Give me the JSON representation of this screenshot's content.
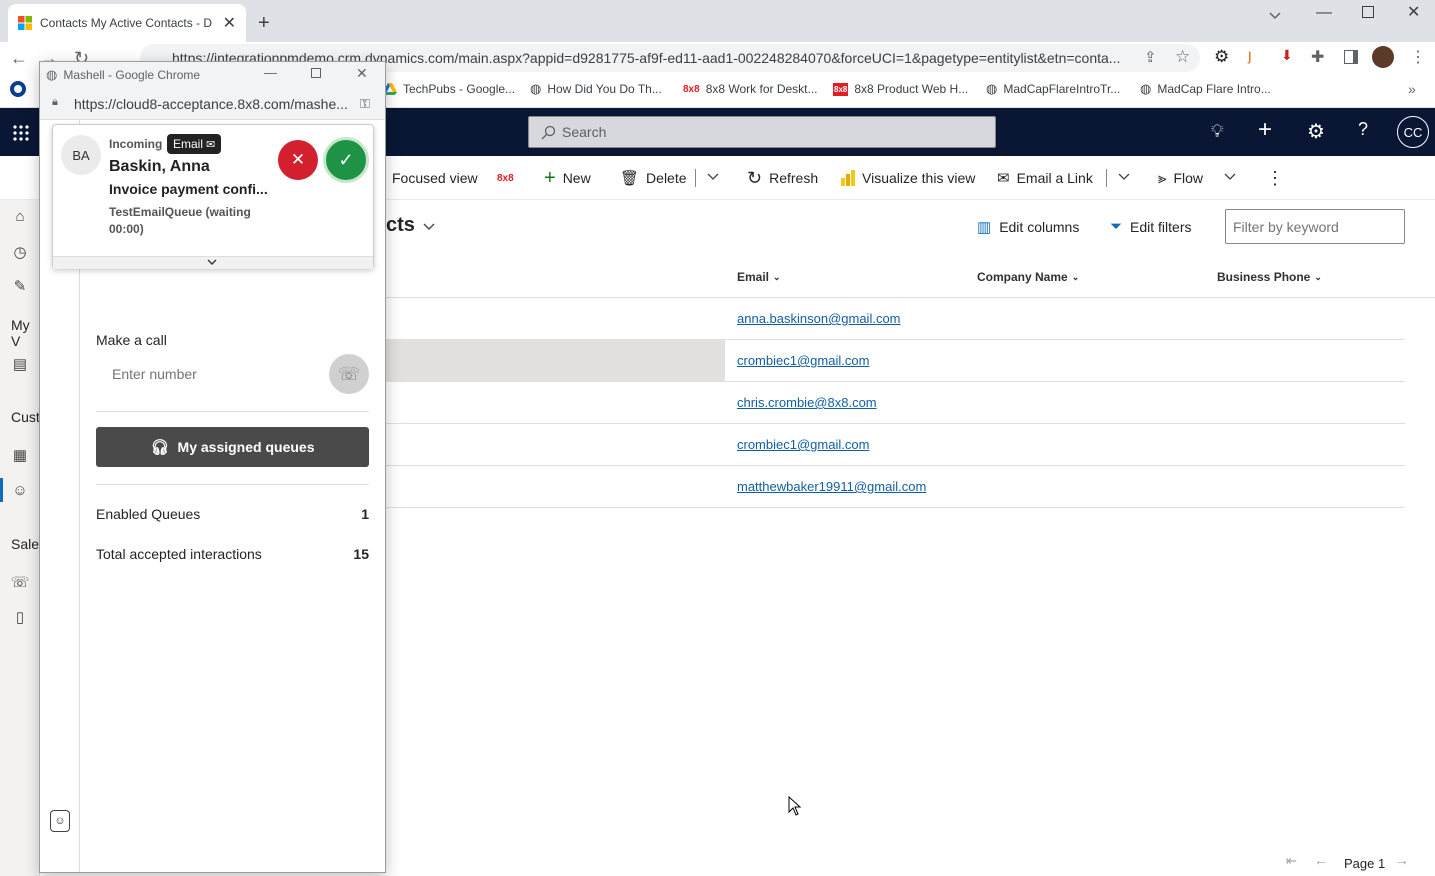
{
  "browser": {
    "tab_title": "Contacts My Active Contacts - D",
    "url": "https://integrationpmdemo.crm.dynamics.com/main.aspx?appid=d9281775-af9f-ed11-aad1-002248284070&forceUCI=1&pagetype=entitylist&etn=conta...",
    "bookmarks": [
      "TechPubs - Google...",
      "How Did You Do Th...",
      "8x8 Work for Deskt...",
      "8x8 Product Web H...",
      "MadCapFlareIntroTr...",
      "MadCap Flare Intro..."
    ],
    "avatar_initials": "CC"
  },
  "d365": {
    "search_placeholder": "Search",
    "user_initials": "CC",
    "commands": {
      "focused_view": "Focused view",
      "eightxeight": "8x8",
      "new": "New",
      "delete": "Delete",
      "refresh": "Refresh",
      "visualize": "Visualize this view",
      "email_link": "Email a Link",
      "flow": "Flow"
    },
    "view_title_fragment": "cts",
    "edit_columns": "Edit columns",
    "edit_filters": "Edit filters",
    "filter_placeholder": "Filter by keyword",
    "columns": {
      "email": "Email",
      "company": "Company Name",
      "phone": "Business Phone"
    },
    "rows": [
      {
        "email": "anna.baskinson@gmail.com"
      },
      {
        "email": "crombiec1@gmail.com"
      },
      {
        "email": "chris.crombie@8x8.com"
      },
      {
        "email": "crombiec1@gmail.com"
      },
      {
        "email": "matthewbaker19911@gmail.com"
      }
    ],
    "nav_labels": {
      "my": "My V",
      "customers": "Cust",
      "sales": "Sales"
    },
    "page_label": "Page 1"
  },
  "popup": {
    "window_title": "Mashell - Google Chrome",
    "url": "https://cloud8-acceptance.8x8.com/mashe...",
    "card": {
      "avatar": "BA",
      "status": "Incoming",
      "channel": "Email",
      "name": "Baskin, Anna",
      "subject": "Invoice payment confi...",
      "queue": "TestEmailQueue (waiting 00:00)"
    },
    "make_call_label": "Make a call",
    "number_placeholder": "Enter number",
    "assigned_queues_button": "My assigned queues",
    "stats": [
      {
        "label": "Enabled Queues",
        "value": "1"
      },
      {
        "label": "Total accepted interactions",
        "value": "15"
      }
    ]
  }
}
